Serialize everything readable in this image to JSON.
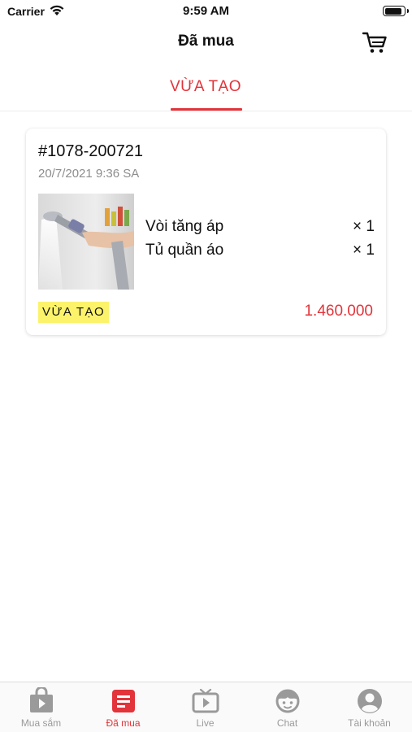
{
  "status_bar": {
    "carrier": "Carrier",
    "time": "9:59 AM",
    "battery_level": 0.9
  },
  "header": {
    "title": "Đã mua",
    "cart_icon": "cart-icon"
  },
  "tabs": [
    {
      "label": "VỪA TẠO",
      "selected": true
    }
  ],
  "order": {
    "id": "#1078-200721",
    "date": "20/7/2021 9:36 SA",
    "image_icon": "shower-head-photo",
    "items": [
      {
        "name": "Vòi tăng áp",
        "qty": "× 1"
      },
      {
        "name": "Tủ quần áo",
        "qty": "× 1"
      }
    ],
    "status": "VỪA TẠO",
    "total": "1.460.000"
  },
  "tab_bar": {
    "items": [
      {
        "label": "Mua sắm",
        "icon": "shopping-bag-play-icon",
        "active": false
      },
      {
        "label": "Đã mua",
        "icon": "document-list-icon",
        "active": true
      },
      {
        "label": "Live",
        "icon": "tv-play-icon",
        "active": false
      },
      {
        "label": "Chat",
        "icon": "support-agent-icon",
        "active": false
      },
      {
        "label": "Tài khoản",
        "icon": "user-account-icon",
        "active": false
      }
    ]
  },
  "colors": {
    "accent": "#e2343a",
    "badge": "#fcf36b",
    "inactive": "#9a9a9a"
  }
}
